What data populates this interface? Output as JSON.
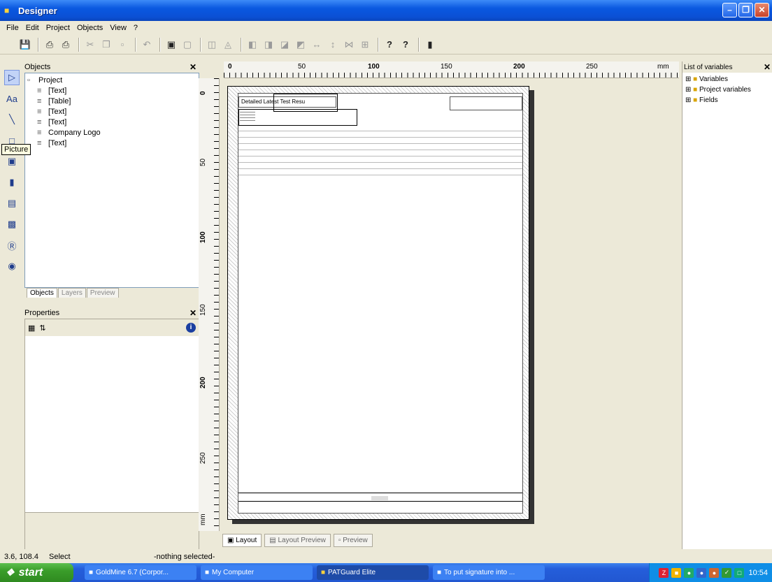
{
  "window": {
    "title": "Designer"
  },
  "menu": [
    "File",
    "Edit",
    "Project",
    "Objects",
    "View",
    "?"
  ],
  "toolbar": {
    "icons": [
      "save-icon",
      "print-icon",
      "print-preview-icon",
      "cut-icon",
      "copy-icon",
      "paste-icon",
      "undo-icon",
      "bring-front-icon",
      "send-back-icon",
      "align-left-icon",
      "align-center-icon",
      "align-right-icon",
      "align-top-icon",
      "align-middle-icon",
      "align-bottom-icon",
      "help-icon",
      "context-help-icon",
      "exit-icon"
    ],
    "help_label": "?",
    "context_help_label": "?"
  },
  "tools": {
    "items": [
      "select-tool",
      "text-tool",
      "line-tool",
      "rectangle-tool",
      "picture-tool",
      "barcode-tool",
      "table-tool",
      "chart-tool",
      "formatted-text-tool",
      "html-tool"
    ],
    "text_tool_label": "Aa",
    "tooltip": "Picture"
  },
  "objects_panel": {
    "title": "Objects",
    "root": "Project",
    "items": [
      "[Text]",
      "[Table]",
      "[Text]",
      "[Text]",
      "Company Logo",
      "[Text]"
    ],
    "tabs": [
      "Objects",
      "Layers",
      "Preview"
    ]
  },
  "properties_panel": {
    "title": "Properties"
  },
  "ruler": {
    "unit": "mm",
    "h_ticks": [
      "0",
      "50",
      "100",
      "150",
      "200",
      "250"
    ],
    "v_ticks": [
      "0",
      "50",
      "100",
      "150",
      "200",
      "250",
      "mm"
    ]
  },
  "report": {
    "title_text": "Detailed Latest Test Resu"
  },
  "bottom_tabs": [
    "Layout",
    "Layout Preview",
    "Preview"
  ],
  "variables_panel": {
    "title": "List of variables",
    "items": [
      "Variables",
      "Project variables",
      "Fields"
    ]
  },
  "status": {
    "coords": "3.6, 108.4",
    "mode": "Select",
    "selection": "-nothing selected-"
  },
  "taskbar": {
    "start": "start",
    "tasks": [
      "GoldMine 6.7 (Corpor...",
      "My Computer",
      "PATGuard Elite",
      "To put signature into ..."
    ],
    "clock": "10:54"
  }
}
